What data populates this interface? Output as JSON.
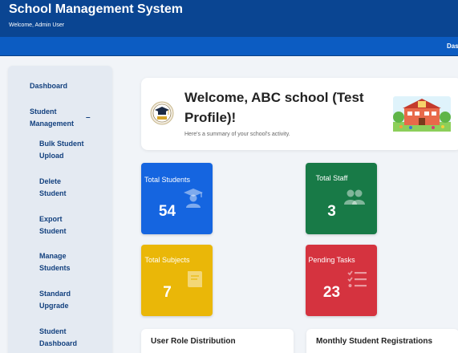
{
  "header": {
    "title": "School Management System",
    "welcome": "Welcome, Admin User"
  },
  "navbar": {
    "item": "Dashboard"
  },
  "sidebar": {
    "dashboard": "Dashboard",
    "student_management": "Student Management",
    "toggle": "–",
    "sub_items": [
      "Bulk Student Upload",
      "Delete Student",
      "Export Student",
      "Manage Students",
      "Standard Upgrade",
      "Student Dashboard"
    ]
  },
  "welcome_card": {
    "title": "Welcome, ABC school (Test Profile)!",
    "subtitle": "Here's a summary of your school's activity."
  },
  "stats": [
    {
      "label": "Total Students",
      "value": "54",
      "icon": "graduate-icon",
      "color": "#1565e0"
    },
    {
      "label": "Total Staff",
      "value": "3",
      "icon": "users-icon",
      "color": "#187a47"
    },
    {
      "label": "Total Subjects",
      "value": "7",
      "icon": "book-icon",
      "color": "#eab708"
    },
    {
      "label": "Pending Tasks",
      "value": "23",
      "icon": "tasks-icon",
      "color": "#d5333f"
    }
  ],
  "charts": {
    "role_title": "User Role Distribution",
    "registrations_title": "Monthly Student Registrations"
  }
}
